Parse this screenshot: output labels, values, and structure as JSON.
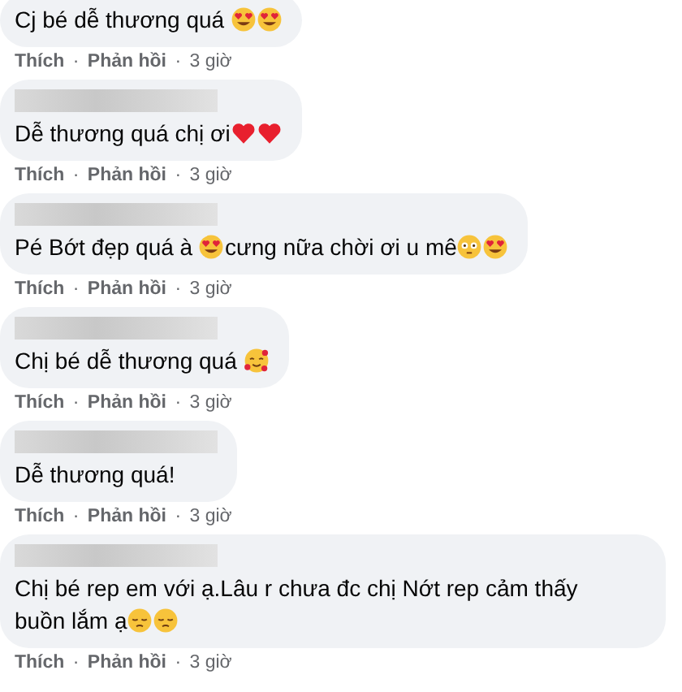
{
  "comments": [
    {
      "parts": [
        {
          "kind": "text",
          "text": "Cj bé dễ thương quá "
        },
        {
          "kind": "heart-eyes"
        },
        {
          "kind": "heart-eyes"
        }
      ],
      "like": "Thích",
      "sep_1": "·",
      "reply": "Phản hồi",
      "sep_2": "·",
      "time": "3 giờ"
    },
    {
      "name_hidden": true,
      "parts": [
        {
          "kind": "text",
          "text": "Dễ thương quá chị ơi"
        },
        {
          "kind": "heart"
        },
        {
          "kind": "heart"
        }
      ],
      "like": "Thích",
      "sep_1": "·",
      "reply": "Phản hồi",
      "sep_2": "·",
      "time": "3 giờ"
    },
    {
      "name_hidden": true,
      "parts": [
        {
          "kind": "text",
          "text": "Pé Bớt đẹp quá à "
        },
        {
          "kind": "heart-eyes"
        },
        {
          "kind": "text",
          "text": "cưng nữa chời ơi u mê"
        },
        {
          "kind": "flushed"
        },
        {
          "kind": "heart-eyes"
        }
      ],
      "like": "Thích",
      "sep_1": "·",
      "reply": "Phản hồi",
      "sep_2": "·",
      "time": "3 giờ"
    },
    {
      "name_hidden": true,
      "parts": [
        {
          "kind": "text",
          "text": "Chị bé dễ thương quá "
        },
        {
          "kind": "hearts-face"
        }
      ],
      "like": "Thích",
      "sep_1": "·",
      "reply": "Phản hồi",
      "sep_2": "·",
      "time": "3 giờ"
    },
    {
      "name_hidden": true,
      "parts": [
        {
          "kind": "text",
          "text": "Dễ thương quá!"
        }
      ],
      "like": "Thích",
      "sep_1": "·",
      "reply": "Phản hồi",
      "sep_2": "·",
      "time": "3 giờ"
    },
    {
      "name_hidden": true,
      "parts": [
        {
          "kind": "text",
          "text": "Chị bé rep em với ạ.Lâu r chưa đc chị Nớt rep cảm thấy"
        },
        {
          "kind": "text",
          "text": "buồn lắm ạ"
        },
        {
          "kind": "pensive"
        },
        {
          "kind": "pensive"
        }
      ],
      "like": "Thích",
      "sep_1": "·",
      "reply": "Phản hồi",
      "sep_2": "·",
      "time": "3 giờ"
    }
  ]
}
